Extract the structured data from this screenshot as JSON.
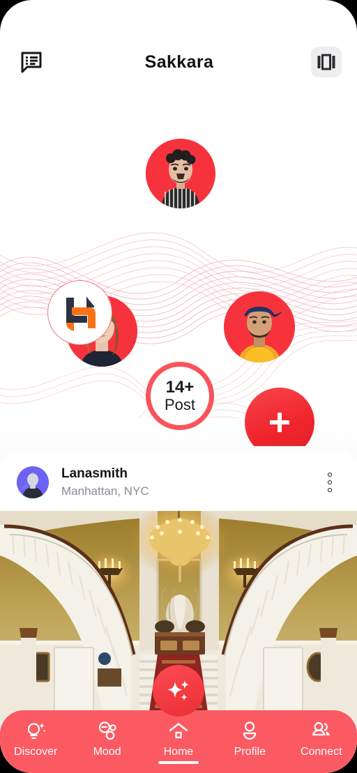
{
  "header": {
    "title": "Sakkara",
    "left_icon": "messages-list-icon",
    "right_icon": "carousel-layout-icon"
  },
  "hero": {
    "count_bubble": {
      "count": "14+",
      "label": "Post"
    },
    "avatars": [
      {
        "name": "avatar-bubble-woman",
        "bg": "#F6333C"
      },
      {
        "name": "avatar-bubble-man-striped",
        "bg": "#F6333C"
      },
      {
        "name": "avatar-bubble-man-cap",
        "bg": "#F6333C"
      }
    ],
    "logos": [
      {
        "name": "logo-bubble-h-mark",
        "colors": [
          "#2B3245",
          "#F97316"
        ]
      },
      {
        "name": "logo-bubble-interlock-mark",
        "colors": [
          "#E8492B",
          "#29A3DC",
          "#6FBE44"
        ]
      }
    ],
    "add_buttons": [
      {
        "name": "add-button-right",
        "label": "+"
      },
      {
        "name": "add-button-bottom",
        "label": "+"
      }
    ]
  },
  "post": {
    "author": "Lanasmith",
    "location": "Manhattan, NYC",
    "more_icon": "more-vertical-icon",
    "image_alt": "mansion-grand-foyer-double-staircase"
  },
  "fab": {
    "icon": "sparkle-icon"
  },
  "bottom_nav": {
    "active_index": 2,
    "items": [
      {
        "label": "Discover",
        "icon": "lightbulb-sparkle-icon"
      },
      {
        "label": "Mood",
        "icon": "mood-circles-icon"
      },
      {
        "label": "Home",
        "icon": "home-icon"
      },
      {
        "label": "Profile",
        "icon": "person-icon"
      },
      {
        "label": "Connect",
        "icon": "people-group-icon"
      }
    ]
  },
  "colors": {
    "brand_red": "#F6333C",
    "nav_bar": "#FB5A62",
    "accent_soft": "#F9535A",
    "avatar_purple": "#6C63F5",
    "text_dark": "#14151a",
    "text_muted": "#8b8d96"
  }
}
